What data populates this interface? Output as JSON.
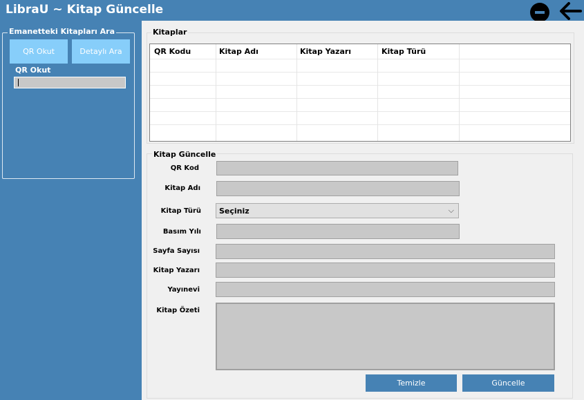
{
  "window": {
    "title": "LibraU ~ Kitap Güncelle",
    "minimize_icon": "minus-circle-icon",
    "back_icon": "arrow-left-icon"
  },
  "left_panel": {
    "group_title": "Emanetteki Kitapları Ara",
    "qr_button": "QR Okut",
    "detail_button": "Detaylı Ara",
    "qr_label": "QR Okut",
    "qr_value": ""
  },
  "books": {
    "group_title": "Kitaplar",
    "columns": [
      "QR Kodu",
      "Kitap Adı",
      "Kitap Yazarı",
      "Kitap Türü"
    ],
    "rows": []
  },
  "update_form": {
    "group_title": "Kitap Güncelle",
    "labels": {
      "qr_kod": "QR Kod",
      "kitap_adi": "Kitap Adı",
      "kitap_turu": "Kitap Türü",
      "basim_yili": "Basım Yılı",
      "sayfa_sayisi": "Sayfa Sayısı",
      "kitap_yazari": "Kitap Yazarı",
      "yayinevi": "Yayınevi",
      "kitap_ozeti": "Kitap Özeti"
    },
    "kitap_turu_selected": "Seçiniz",
    "clear_button": "Temizle",
    "update_button": "Güncelle"
  },
  "colors": {
    "accent": "#4682b4",
    "light_button": "#87cefa",
    "panel_bg": "#f0f0f0",
    "field_bg": "#c8c8c8"
  }
}
